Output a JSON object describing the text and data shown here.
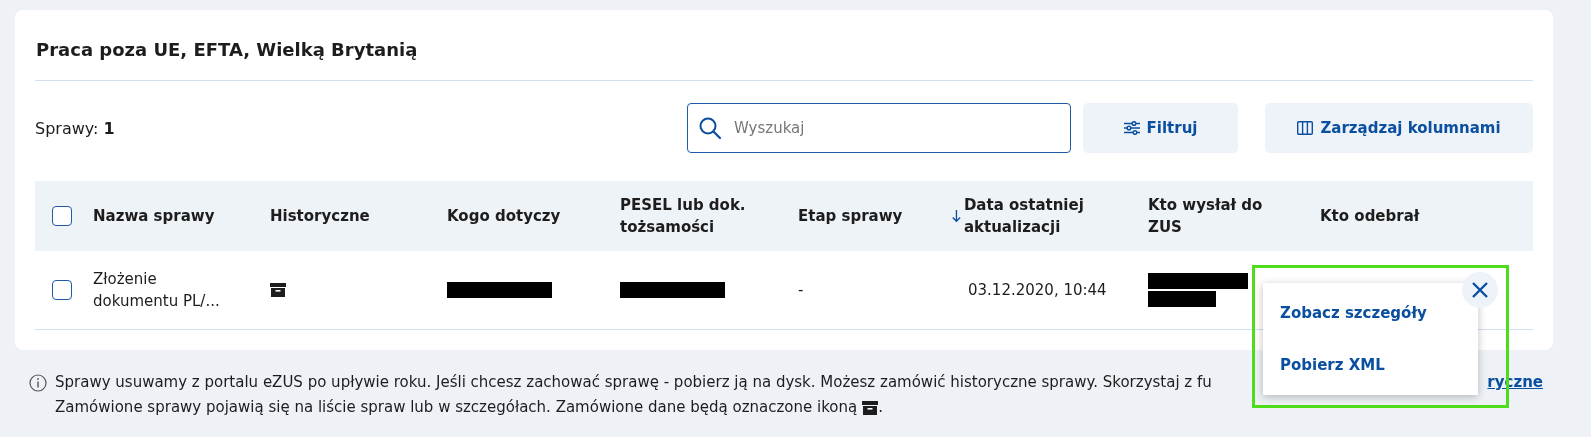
{
  "panel": {
    "title": "Praca poza UE, EFTA, Wielką Brytanią"
  },
  "count": "Sprawy: **1**",
  "search": {
    "placeholder": "Wyszukaj"
  },
  "buttons": [
    {
      "kind": "filter",
      "label": "Filtruj"
    },
    {
      "kind": "columns",
      "label": "Zarządzaj kolumnami"
    }
  ],
  "table": {
    "select_all": {
      "checked": false
    },
    "columns": [
      {
        "label": "Nazwa sprawy",
        "sorted": false
      },
      {
        "label": "Historyczne",
        "sorted": false
      },
      {
        "label": "Kogo dotyczy",
        "sorted": false
      },
      {
        "label": "PESEL lub dok. tożsamości",
        "sorted": false
      },
      {
        "label": "Etap sprawy",
        "sorted": false
      },
      {
        "label": "Data ostatniej aktualizacji",
        "sorted": true
      },
      {
        "label": "Kto wysłał do ZUS",
        "sorted": false
      },
      {
        "label": "Kto odebrał",
        "sorted": false
      }
    ],
    "rows": [
      {
        "checked": false,
        "cells": [
          {
            "kind": "text",
            "text": "Złożenie dokumentu PL/..."
          },
          {
            "kind": "archive"
          },
          {
            "kind": "redacted"
          },
          {
            "kind": "redacted"
          },
          {
            "kind": "text",
            "text": "-"
          },
          {
            "kind": "text",
            "text": "03.12.2020, 10:44"
          },
          {
            "kind": "redacted-double"
          },
          {
            "kind": "empty"
          }
        ]
      }
    ]
  },
  "row_menu": {
    "items": [
      "Zobacz szczegóły",
      "Pobierz XML"
    ],
    "highlighted": true
  },
  "note": {
    "line_1": "Sprawy usuwamy z portalu eZUS po upływie roku. Jeśli chcesz zachować sprawę - pobierz ją na dysk. Możesz zamówić historyczne sprawy. Skorzystaj z fu",
    "link": "ryczne",
    "line_2": "Zamówione sprawy pojawią się na liście spraw lub w szczegółach. Zamówione dane będą oznaczone ikoną",
    "line_2_end": "."
  }
}
